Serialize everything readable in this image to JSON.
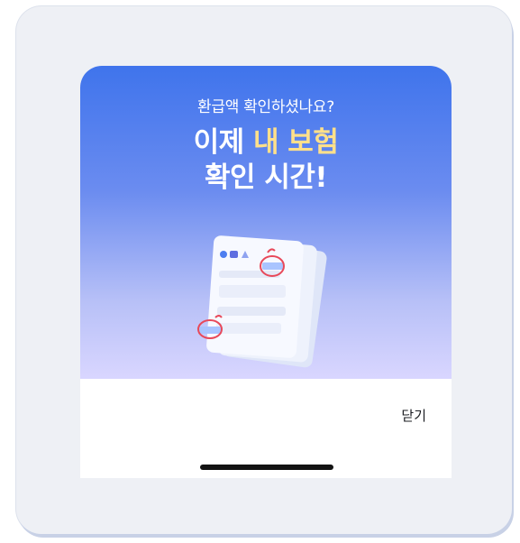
{
  "modal": {
    "subtitle": "환급액 확인하셨나요?",
    "headline_part1": "이제 ",
    "headline_highlight": "내 보험",
    "headline_line2": "확인 시간!",
    "close_label": "닫기"
  },
  "colors": {
    "gradient_top": "#3f74ec",
    "gradient_bottom": "#d9d6ff",
    "highlight": "#ffe08a",
    "mark_red": "#e8495a"
  },
  "icons": {
    "illustration": "insurance-documents-icon"
  }
}
